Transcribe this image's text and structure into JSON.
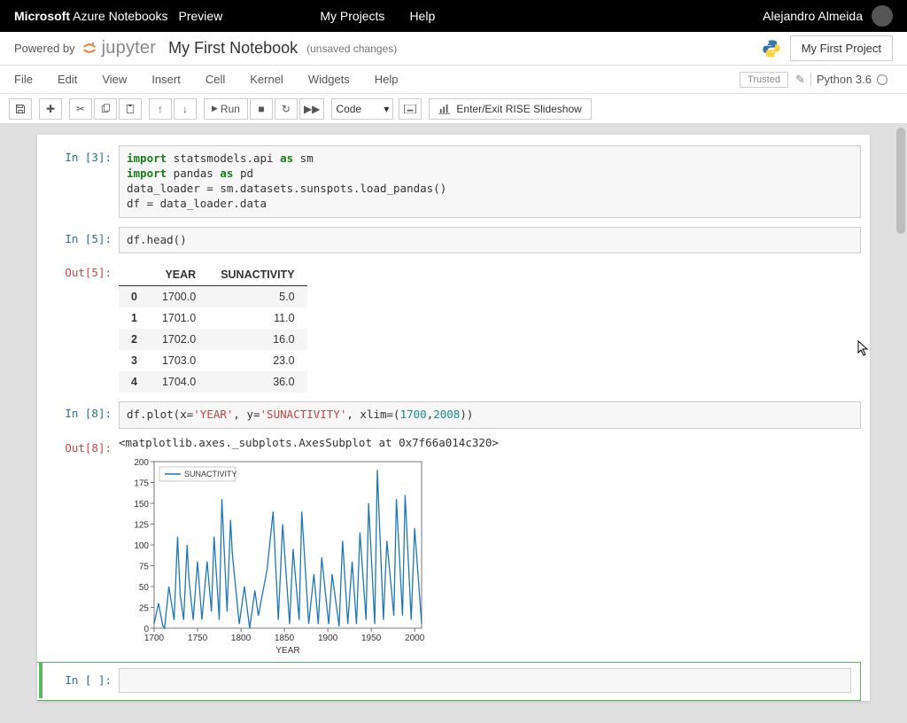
{
  "top": {
    "brand_bold": "Microsoft",
    "brand_rest": " Azure Notebooks",
    "preview": "Preview",
    "my_projects": "My Projects",
    "help": "Help",
    "user": "Alejandro Almeida"
  },
  "header": {
    "powered": "Powered by",
    "jupyter": "jupyter",
    "title": "My First Notebook",
    "status": "(unsaved changes)",
    "project_button": "My First Project"
  },
  "menu": {
    "file": "File",
    "edit": "Edit",
    "view": "View",
    "insert": "Insert",
    "cell": "Cell",
    "kernel": "Kernel",
    "widgets": "Widgets",
    "help": "Help",
    "trusted": "Trusted",
    "kernel_name": "Python 3.6"
  },
  "toolbar": {
    "run": "Run",
    "celltype": "Code",
    "rise": "Enter/Exit RISE Slideshow"
  },
  "cells": {
    "c1_prompt": "In [3]:",
    "c1_code_html": "<span class='kw-green'>import</span> statsmodels.api <span class='kw-bold'>as</span> sm\n<span class='kw-green'>import</span> pandas <span class='kw-bold'>as</span> pd\ndata_loader = sm.datasets.sunspots.load_pandas()\ndf = data_loader.data",
    "c2_prompt": "In [5]:",
    "c2_code_html": "df.head()",
    "c2_out_prompt": "Out[5]:",
    "c3_prompt": "In [8]:",
    "c3_code_html": "df.plot(x=<span class='str-red'>'YEAR'</span>, y=<span class='str-red'>'SUNACTIVITY'</span>, xlim=(<span class='num-teal'>1700</span>,<span class='num-teal'>2008</span>))",
    "c3_out_prompt": "Out[8]:",
    "c3_repr": "<matplotlib.axes._subplots.AxesSubplot at 0x7f66a014c320>",
    "c4_prompt": "In [ ]:"
  },
  "table": {
    "columns": [
      "",
      "YEAR",
      "SUNACTIVITY"
    ],
    "rows": [
      [
        "0",
        "1700.0",
        "5.0"
      ],
      [
        "1",
        "1701.0",
        "11.0"
      ],
      [
        "2",
        "1702.0",
        "16.0"
      ],
      [
        "3",
        "1703.0",
        "23.0"
      ],
      [
        "4",
        "1704.0",
        "36.0"
      ]
    ]
  },
  "chart_data": {
    "type": "line",
    "title": "",
    "xlabel": "YEAR",
    "ylabel": "",
    "xlim": [
      1700,
      2008
    ],
    "ylim": [
      0,
      200
    ],
    "xticks": [
      1700,
      1750,
      1800,
      1850,
      1900,
      1950,
      2000
    ],
    "yticks": [
      0,
      25,
      50,
      75,
      100,
      125,
      150,
      175,
      200
    ],
    "legend": [
      "SUNACTIVITY"
    ],
    "series": [
      {
        "name": "SUNACTIVITY",
        "x": [
          1700,
          1705,
          1710,
          1712,
          1717,
          1720,
          1723,
          1727,
          1730,
          1734,
          1738,
          1740,
          1745,
          1750,
          1755,
          1761,
          1766,
          1769,
          1775,
          1778,
          1784,
          1788,
          1790,
          1798,
          1804,
          1810,
          1816,
          1820,
          1830,
          1837,
          1843,
          1848,
          1856,
          1860,
          1867,
          1870,
          1878,
          1884,
          1889,
          1893,
          1901,
          1905,
          1913,
          1917,
          1923,
          1928,
          1933,
          1937,
          1944,
          1947,
          1954,
          1957,
          1964,
          1968,
          1976,
          1979,
          1986,
          1989,
          1996,
          2000,
          2008
        ],
        "y": [
          5,
          30,
          3,
          0,
          50,
          30,
          10,
          110,
          40,
          10,
          100,
          60,
          10,
          80,
          10,
          80,
          20,
          110,
          10,
          155,
          20,
          130,
          90,
          5,
          50,
          0,
          45,
          15,
          70,
          140,
          10,
          125,
          5,
          95,
          10,
          140,
          5,
          65,
          5,
          85,
          5,
          65,
          2,
          105,
          5,
          80,
          5,
          115,
          10,
          150,
          5,
          190,
          10,
          105,
          15,
          155,
          15,
          160,
          10,
          120,
          5
        ]
      }
    ]
  }
}
